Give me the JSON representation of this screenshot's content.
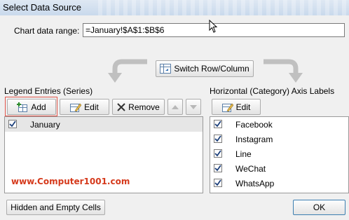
{
  "window": {
    "title": "Select Data Source"
  },
  "range": {
    "label": "Chart data range:",
    "value": "=January!$A$1:$B$6"
  },
  "switch_button": {
    "label": "Switch Row/Column"
  },
  "legend": {
    "label": "Legend Entries (Series)",
    "add_label": "Add",
    "edit_label": "Edit",
    "remove_label": "Remove",
    "items": [
      {
        "label": "January",
        "checked": true
      }
    ]
  },
  "axis": {
    "label": "Horizontal (Category) Axis Labels",
    "edit_label": "Edit",
    "items": [
      {
        "label": "Facebook",
        "checked": true
      },
      {
        "label": "Instagram",
        "checked": true
      },
      {
        "label": "Line",
        "checked": true
      },
      {
        "label": "WeChat",
        "checked": true
      },
      {
        "label": "WhatsApp",
        "checked": true
      }
    ]
  },
  "watermark": "www.Computer1001.com",
  "footer": {
    "hidden_cells_label": "Hidden and Empty Cells",
    "ok_label": "OK"
  },
  "colors": {
    "highlight": "#e0554a",
    "watermark": "#d53a1c",
    "selection": "#e6e6e6"
  },
  "icons": {
    "switch": "switch-table-icon",
    "add": "add-table-icon",
    "edit": "edit-table-icon",
    "remove": "x-icon",
    "move_up": "triangle-up-icon",
    "move_down": "triangle-down-icon"
  }
}
